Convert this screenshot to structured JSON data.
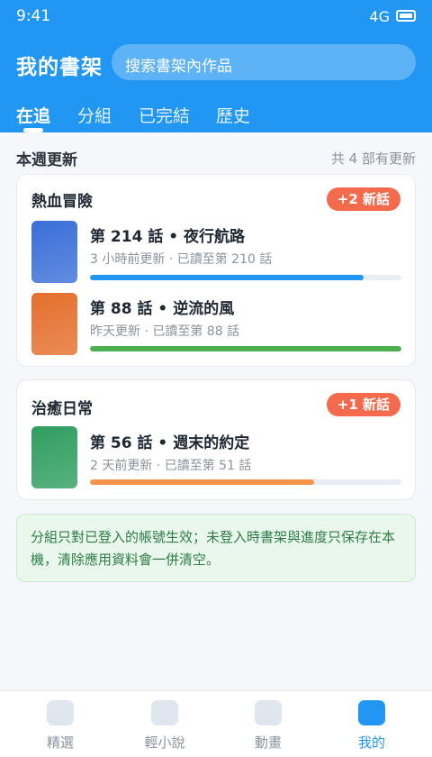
{
  "status_bar": {
    "time": "9:41",
    "signal": "4G"
  },
  "header": {
    "title": "我的書架",
    "search": {
      "placeholder": "搜索書架內作品"
    },
    "tabs": [
      {
        "label": "在追",
        "active": true
      },
      {
        "label": "分組",
        "active": false
      },
      {
        "label": "已完結",
        "active": false
      },
      {
        "label": "歷史",
        "active": false
      }
    ]
  },
  "section": {
    "title": "本週更新",
    "count": "共 4 部有更新"
  },
  "cards": [
    {
      "title": "熱血冒險",
      "badge": "+2 新話",
      "episodes": [
        {
          "title": "第 214 話 • 夜行航路",
          "subtitle": "3 小時前更新 · 已讀至第 210 話",
          "progress": 0.88,
          "color": "#2196f3",
          "cover_color": "#3a6fd8"
        },
        {
          "title": "第 88 話 • 逆流的風",
          "subtitle": "昨天更新 · 已讀至第 88 話",
          "progress": 1.0,
          "color": "#4caf50",
          "cover_color": "#e46f2c"
        }
      ]
    },
    {
      "title": "治癒日常",
      "badge": "+1 新話",
      "episodes": [
        {
          "title": "第 56 話 • 週末的約定",
          "subtitle": "2 天前更新 · 已讀至第 51 話",
          "progress": 0.72,
          "color": "#f5934a",
          "cover_color": "#2f9e60"
        }
      ]
    }
  ],
  "notice": "分組只對已登入的帳號生效；未登入時書架與進度只保存在本機，清除應用資料會一併清空。",
  "bottom_nav": [
    {
      "label": "精選",
      "active": false
    },
    {
      "label": "輕小說",
      "active": false
    },
    {
      "label": "動畫",
      "active": false
    },
    {
      "label": "我的",
      "active": true
    }
  ]
}
